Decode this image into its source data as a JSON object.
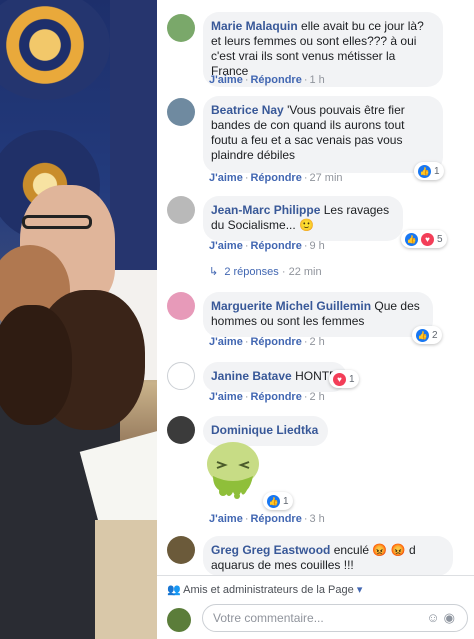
{
  "comments": [
    {
      "author": "Marie Malaquin",
      "text": "elle avait bu ce jour là? et leurs femmes ou sont elles??? à oui c'est vrai ils sont venus métisser la France",
      "like": "J'aime",
      "reply": "Répondre",
      "time": "1 h",
      "avatar_color": "#7aa86a"
    },
    {
      "author": "Beatrice Nay",
      "text": "'Vous pouvais être fier bandes de con quand ils aurons tout foutu a feu et a sac venais pas vous plaindre débiles",
      "like": "J'aime",
      "reply": "Répondre",
      "time": "27 min",
      "reactions": "1",
      "avatar_color": "#6f8aa0"
    },
    {
      "author": "Jean-Marc Philippe",
      "text": "Les ravages du Socialisme...",
      "emoji": "🙂",
      "like": "J'aime",
      "reply": "Répondre",
      "time": "9 h",
      "reactions": "5",
      "replies_label": "2 réponses",
      "replies_time": "22 min",
      "avatar_color": "#b9b9b9"
    },
    {
      "author": "Marguerite Michel Guillemin",
      "text": "Que des hommes ou sont les femmes",
      "like": "J'aime",
      "reply": "Répondre",
      "time": "2 h",
      "reactions": "2",
      "avatar_color": "#e79ab9"
    },
    {
      "author": "Janine Batave",
      "text": "HONTE",
      "like": "J'aime",
      "reply": "Répondre",
      "time": "2 h",
      "reactions": "1",
      "avatar_color": "#ffffff"
    },
    {
      "author": "Dominique Liedtka",
      "like": "J'aime",
      "reply": "Répondre",
      "time": "3 h",
      "reactions": "1",
      "avatar_color": "#3b3b3b"
    },
    {
      "author": "Greg Greg Eastwood",
      "text": "enculé",
      "text2": "d aquarus de mes couilles !!!",
      "avatar_color": "#6b5a3a"
    }
  ],
  "footer": {
    "audience": "Amis et administrateurs de la Page",
    "placeholder": "Votre commentaire..."
  },
  "colors": {
    "link": "#385898",
    "like": "#1877f2",
    "love": "#f33e58"
  }
}
